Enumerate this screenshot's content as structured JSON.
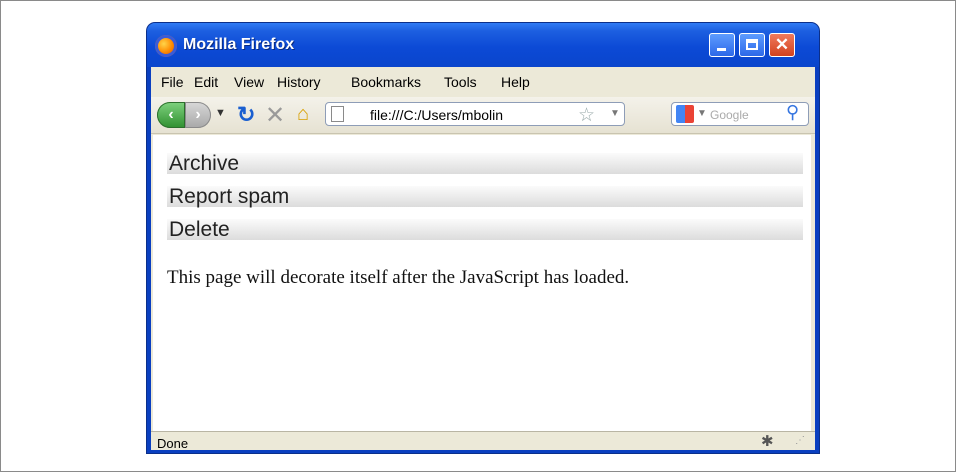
{
  "window": {
    "title": "Mozilla Firefox"
  },
  "menubar": {
    "items": [
      "File",
      "Edit",
      "View",
      "History",
      "Bookmarks",
      "Tools",
      "Help"
    ]
  },
  "navbar": {
    "url": "file:///C:/Users/mbolin",
    "search_placeholder": "Google"
  },
  "page": {
    "menu_items": [
      "Archive",
      "Report spam",
      "Delete"
    ],
    "message": "This page will decorate itself after the JavaScript has loaded."
  },
  "status": {
    "text": "Done"
  },
  "icons": {
    "app": "firefox-icon",
    "back": "back-arrow-icon",
    "forward": "forward-arrow-icon",
    "reload": "reload-icon",
    "stop": "stop-icon",
    "home": "home-icon",
    "page": "page-icon",
    "star": "star-icon",
    "search_engine": "google-icon",
    "search": "magnifier-icon",
    "status": "bug-icon"
  }
}
